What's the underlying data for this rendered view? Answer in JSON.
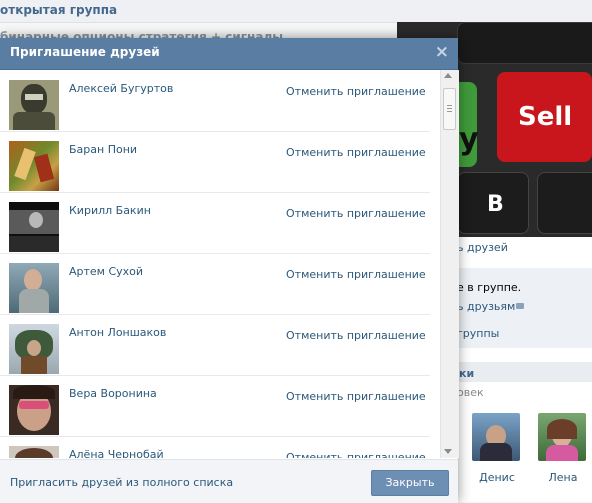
{
  "background": {
    "header_text": "открытая группа",
    "subtitle": "бинарные опционы стратегия + сигналы",
    "photo_keys": {
      "sell": "Sell",
      "b": "B",
      "y": "y"
    },
    "invite_link": "ь друзей",
    "member_text": "е в группе.",
    "tell_friends": "ь друзьям",
    "group_link": "группы",
    "section_head": "ки",
    "people_count": "овек",
    "members": [
      {
        "name": "Денис"
      },
      {
        "name": "Лена"
      }
    ]
  },
  "dialog": {
    "title": "Приглашение друзей",
    "close_icon": "×",
    "cancel_label": "Отменить приглашение",
    "friends": [
      {
        "name": "Алексей Бугуртов"
      },
      {
        "name": "Баран Пони"
      },
      {
        "name": "Кирилл Бакин"
      },
      {
        "name": "Артем Сухой"
      },
      {
        "name": "Антон Лоншаков"
      },
      {
        "name": "Вера Воронина"
      },
      {
        "name": "Алёна Чернобай"
      }
    ],
    "footer_link": "Пригласить друзей из полного списка",
    "close_button": "Закрыть"
  }
}
